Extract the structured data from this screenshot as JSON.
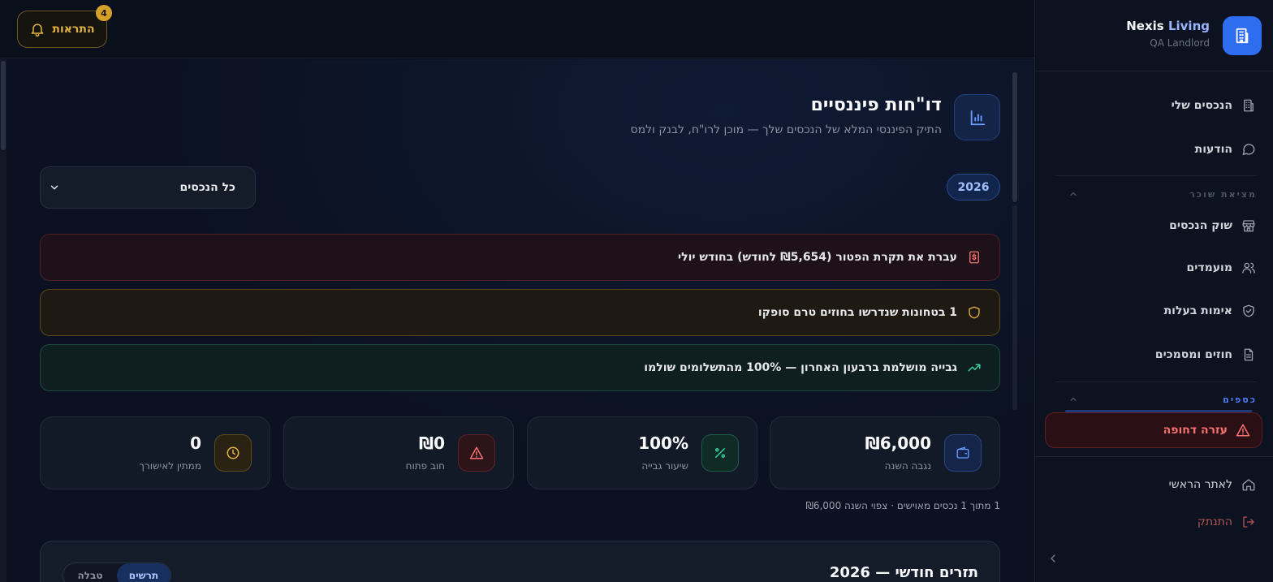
{
  "topbar": {
    "notifications_label": "התראות",
    "notifications_count": "4"
  },
  "sidebar": {
    "brand_name_main": "Nexis",
    "brand_name_accent": "Living",
    "brand_sub": "QA Landlord",
    "items_top": [
      {
        "label": "הנכסים שלי",
        "icon": "building-icon"
      },
      {
        "label": "הודעות",
        "icon": "chat-bubble-icon"
      }
    ],
    "section_tenant": "מציאת שוכר",
    "items_tenant": [
      {
        "label": "שוק הנכסים",
        "icon": "store-icon"
      },
      {
        "label": "מועמדים",
        "icon": "users-icon"
      },
      {
        "label": "אימות בעלות",
        "icon": "shield-check-icon"
      },
      {
        "label": "חוזים ומסמכים",
        "icon": "document-icon"
      }
    ],
    "section_finance": "כספים",
    "emergency_label": "עזרה דחופה",
    "home_label": "לאתר הראשי",
    "logout_label": "התנתק"
  },
  "page": {
    "title": "דו\"חות פיננסיים",
    "subtitle": "התיק הפיננסי המלא של הנכסים שלך — מוכן לרו\"ח, לבנק ולמס",
    "year": "2026",
    "property_filter": "כל הנכסים"
  },
  "alerts": [
    {
      "text": "עברת את תקרת הפטור (₪5,654 לחודש) בחודש יולי",
      "icon": "dollar-doc-icon",
      "tone": "red"
    },
    {
      "text": "1 בטחונות שנדרשו בחוזים טרם סופקו",
      "icon": "shield-icon",
      "tone": "amber"
    },
    {
      "text": "גבייה מושלמת ברבעון האחרון — 100% מהתשלומים שולמו",
      "icon": "trending-up-icon",
      "tone": "green"
    }
  ],
  "stats": [
    {
      "value": "₪6,000",
      "label": "נגבה השנה",
      "icon": "wallet-icon"
    },
    {
      "value": "100%",
      "label": "שיעור גבייה",
      "icon": "percent-icon"
    },
    {
      "value": "₪0",
      "label": "חוב פתוח",
      "icon": "warning-icon"
    },
    {
      "value": "0",
      "label": "ממתין לאישורך",
      "icon": "clock-icon"
    }
  ],
  "summary": "1 מתוך 1 נכסים מאוישים · צפוי השנה ₪6,000",
  "chart_section": {
    "title": "תזרים חודשי — 2026",
    "toggle": [
      "תרשים",
      "טבלה"
    ]
  },
  "colors": {
    "accent": "#2f6df0",
    "amber": "#e3b341",
    "danger": "#f87171",
    "success": "#34d399"
  }
}
